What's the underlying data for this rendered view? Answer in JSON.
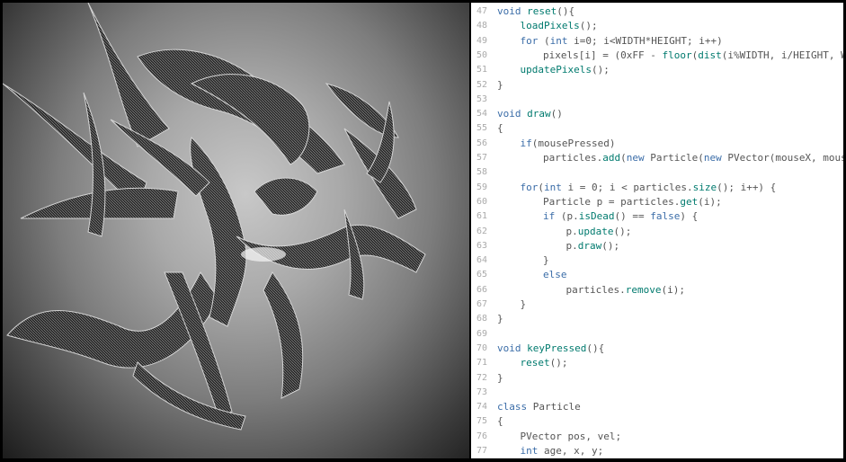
{
  "canvas": {
    "description_icon": "particle-sketch-canvas"
  },
  "editor": {
    "lines": [
      {
        "n": "47",
        "indent": 0,
        "tokens": [
          [
            "kw",
            "void "
          ],
          [
            "fn",
            "reset"
          ],
          [
            "pu",
            "(){"
          ]
        ]
      },
      {
        "n": "48",
        "indent": 1,
        "tokens": [
          [
            "fn",
            "loadPixels"
          ],
          [
            "pu",
            "();"
          ]
        ]
      },
      {
        "n": "49",
        "indent": 1,
        "tokens": [
          [
            "kw",
            "for "
          ],
          [
            "pu",
            "("
          ],
          [
            "kw",
            "int "
          ],
          [
            "pu",
            "i=0; i<WIDTH*HEIGHT; i++)"
          ]
        ]
      },
      {
        "n": "50",
        "indent": 2,
        "tokens": [
          [
            "pu",
            "pixels[i] = (0xFF - "
          ],
          [
            "fn",
            "floor"
          ],
          [
            "pu",
            "("
          ],
          [
            "fn",
            "dist"
          ],
          [
            "pu",
            "(i%WIDTH, i/HEIGHT, WI"
          ]
        ]
      },
      {
        "n": "51",
        "indent": 1,
        "tokens": [
          [
            "fn",
            "updatePixels"
          ],
          [
            "pu",
            "();"
          ]
        ]
      },
      {
        "n": "52",
        "indent": 0,
        "tokens": [
          [
            "pu",
            "}"
          ]
        ]
      },
      {
        "n": "53",
        "indent": 0,
        "tokens": []
      },
      {
        "n": "54",
        "indent": 0,
        "tokens": [
          [
            "kw",
            "void "
          ],
          [
            "fn",
            "draw"
          ],
          [
            "pu",
            "()"
          ]
        ]
      },
      {
        "n": "55",
        "indent": 0,
        "tokens": [
          [
            "pu",
            "{"
          ]
        ]
      },
      {
        "n": "56",
        "indent": 1,
        "tokens": [
          [
            "kw",
            "if"
          ],
          [
            "pu",
            "(mousePressed)"
          ]
        ]
      },
      {
        "n": "57",
        "indent": 2,
        "tokens": [
          [
            "pu",
            "particles."
          ],
          [
            "fn",
            "add"
          ],
          [
            "pu",
            "("
          ],
          [
            "kw",
            "new "
          ],
          [
            "pu",
            "Particle("
          ],
          [
            "kw",
            "new "
          ],
          [
            "pu",
            "PVector(mouseX, mouse"
          ]
        ]
      },
      {
        "n": "58",
        "indent": 0,
        "tokens": []
      },
      {
        "n": "59",
        "indent": 1,
        "tokens": [
          [
            "kw",
            "for"
          ],
          [
            "pu",
            "("
          ],
          [
            "kw",
            "int "
          ],
          [
            "pu",
            "i = 0; i < particles."
          ],
          [
            "fn",
            "size"
          ],
          [
            "pu",
            "(); i++) {"
          ]
        ]
      },
      {
        "n": "60",
        "indent": 2,
        "tokens": [
          [
            "pu",
            "Particle p = particles."
          ],
          [
            "fn",
            "get"
          ],
          [
            "pu",
            "(i);"
          ]
        ]
      },
      {
        "n": "61",
        "indent": 2,
        "tokens": [
          [
            "kw",
            "if "
          ],
          [
            "pu",
            "(p."
          ],
          [
            "fn",
            "isDead"
          ],
          [
            "pu",
            "() == "
          ],
          [
            "kw",
            "false"
          ],
          [
            "pu",
            ") {"
          ]
        ]
      },
      {
        "n": "62",
        "indent": 3,
        "tokens": [
          [
            "pu",
            "p."
          ],
          [
            "fn",
            "update"
          ],
          [
            "pu",
            "();"
          ]
        ]
      },
      {
        "n": "63",
        "indent": 3,
        "tokens": [
          [
            "pu",
            "p."
          ],
          [
            "fn",
            "draw"
          ],
          [
            "pu",
            "();"
          ]
        ]
      },
      {
        "n": "64",
        "indent": 2,
        "tokens": [
          [
            "pu",
            "}"
          ]
        ]
      },
      {
        "n": "65",
        "indent": 2,
        "tokens": [
          [
            "kw",
            "else"
          ]
        ]
      },
      {
        "n": "66",
        "indent": 3,
        "tokens": [
          [
            "pu",
            "particles."
          ],
          [
            "fn",
            "remove"
          ],
          [
            "pu",
            "(i);"
          ]
        ]
      },
      {
        "n": "67",
        "indent": 1,
        "tokens": [
          [
            "pu",
            "}"
          ]
        ]
      },
      {
        "n": "68",
        "indent": 0,
        "tokens": [
          [
            "pu",
            "}"
          ]
        ]
      },
      {
        "n": "69",
        "indent": 0,
        "tokens": []
      },
      {
        "n": "70",
        "indent": 0,
        "tokens": [
          [
            "kw",
            "void "
          ],
          [
            "fn",
            "keyPressed"
          ],
          [
            "pu",
            "(){"
          ]
        ]
      },
      {
        "n": "71",
        "indent": 1,
        "tokens": [
          [
            "fn",
            "reset"
          ],
          [
            "pu",
            "();"
          ]
        ]
      },
      {
        "n": "72",
        "indent": 0,
        "tokens": [
          [
            "pu",
            "}"
          ]
        ]
      },
      {
        "n": "73",
        "indent": 0,
        "tokens": []
      },
      {
        "n": "74",
        "indent": 0,
        "tokens": [
          [
            "kw",
            "class "
          ],
          [
            "pu",
            "Particle"
          ]
        ]
      },
      {
        "n": "75",
        "indent": 0,
        "tokens": [
          [
            "pu",
            "{"
          ]
        ]
      },
      {
        "n": "76",
        "indent": 1,
        "tokens": [
          [
            "pu",
            "PVector pos, vel;"
          ]
        ]
      },
      {
        "n": "77",
        "indent": 1,
        "tokens": [
          [
            "kw",
            "int "
          ],
          [
            "pu",
            "age, x, y;"
          ]
        ]
      }
    ]
  },
  "colors": {
    "keyword": "#3b6da8",
    "function": "#007a6e",
    "plain": "#333333",
    "gutter": "#aaaaaa"
  }
}
